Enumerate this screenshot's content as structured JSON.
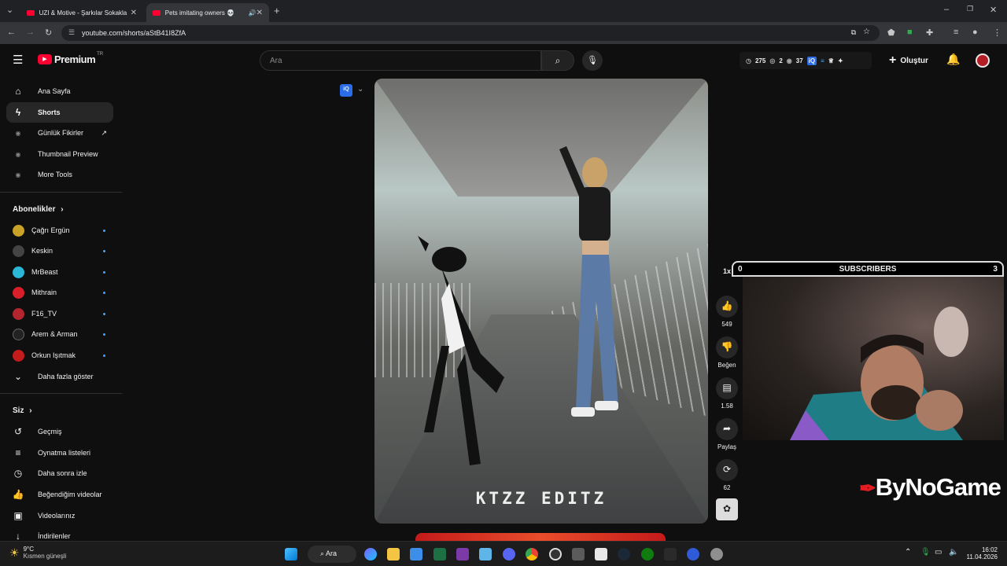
{
  "browser": {
    "tabs": [
      {
        "title": "UZI & Motive - Şarkılar Sokakla",
        "active": false
      },
      {
        "title": "Pets imitating owners 💀",
        "active": true
      }
    ],
    "url": "youtube.com/shorts/aStB41I8ZfA"
  },
  "header": {
    "brand": "Premium",
    "region": "TR",
    "search_placeholder": "Ara",
    "stats": [
      "275",
      "2",
      "37"
    ],
    "create_label": "Oluştur"
  },
  "sidebar": {
    "main": [
      {
        "label": "Ana Sayfa",
        "icon": "home-icon"
      },
      {
        "label": "Shorts",
        "icon": "shorts-icon"
      },
      {
        "label": "Günlük Fikirler",
        "icon": "vidiq-icon"
      },
      {
        "label": "Thumbnail Preview",
        "icon": "vidiq-icon"
      },
      {
        "label": "More Tools",
        "icon": "vidiq-icon"
      }
    ],
    "subs_heading": "Abonelikler",
    "subs": [
      {
        "label": "Çağrı Ergün",
        "color": "#c9a227"
      },
      {
        "label": "Keskin",
        "color": "#444444"
      },
      {
        "label": "MrBeast",
        "color": "#2bb7d6"
      },
      {
        "label": "Mithrain",
        "color": "#d81f2a"
      },
      {
        "label": "F16_TV",
        "color": "#b3262f"
      },
      {
        "label": "Arem & Arman",
        "color": "#222222"
      },
      {
        "label": "Orkun Işıtmak",
        "color": "#c21c1c"
      }
    ],
    "show_more": "Daha fazla göster",
    "you_heading": "Siz",
    "you": [
      {
        "label": "Geçmiş",
        "icon": "history-icon"
      },
      {
        "label": "Oynatma listeleri",
        "icon": "playlist-icon"
      },
      {
        "label": "Daha sonra izle",
        "icon": "clock-icon"
      },
      {
        "label": "Beğendiğim videolar",
        "icon": "thumbs-up-icon"
      },
      {
        "label": "Videolarınız",
        "icon": "video-icon"
      },
      {
        "label": "İndirilenler",
        "icon": "download-icon"
      }
    ]
  },
  "video": {
    "watermark": "KTZZ EDITZ"
  },
  "actions": {
    "speed": "1x",
    "likes": "549",
    "dislike": "Beğen",
    "comments": "1.58",
    "share": "Paylaş",
    "remix": "62"
  },
  "overlay": {
    "left": "0",
    "title": "SUBSCRIBERS",
    "right": "3",
    "logo": "ByNoGame"
  },
  "taskbar": {
    "weather_temp": "9°C",
    "weather_desc": "Kısmen güneşli",
    "search": "Ara",
    "time": "16:02",
    "date": "11.04.2026"
  }
}
